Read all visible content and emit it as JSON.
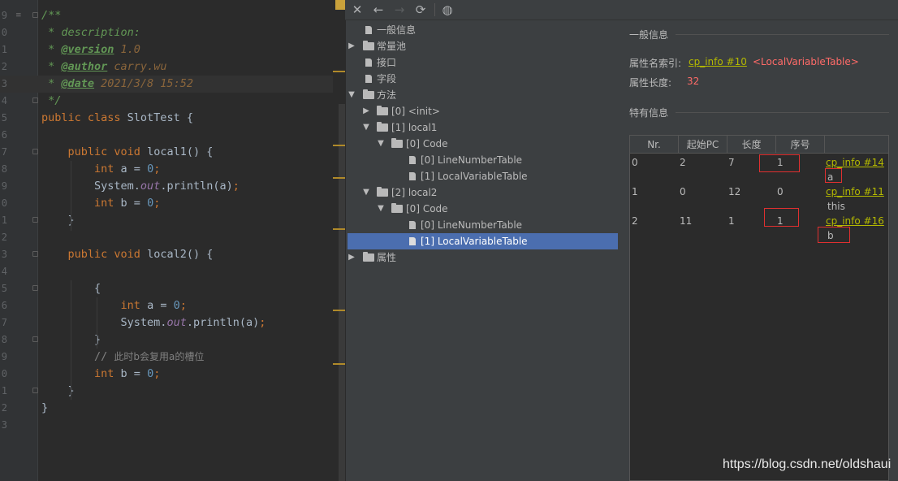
{
  "editor": {
    "line_numbers": [
      "9",
      "0",
      "1",
      "2",
      "3",
      "4",
      "5",
      "6",
      "7",
      "8",
      "9",
      "0",
      "1",
      "2",
      "3",
      "4",
      "5",
      "6",
      "7",
      "8",
      "9",
      "0",
      "1",
      "2",
      "3"
    ]
  },
  "code_lines": [
    [
      {
        "t": "doc",
        "v": "/**"
      }
    ],
    [
      {
        "t": "doc",
        "v": " * description:"
      }
    ],
    [
      {
        "t": "doc",
        "v": " * "
      },
      {
        "t": "tag",
        "v": "@version"
      },
      {
        "t": "tv",
        "v": " 1.0"
      }
    ],
    [
      {
        "t": "doc",
        "v": " * "
      },
      {
        "t": "tag",
        "v": "@author"
      },
      {
        "t": "tv",
        "v": " carry.wu"
      }
    ],
    [
      {
        "t": "doc",
        "v": " * "
      },
      {
        "t": "tag",
        "v": "@date"
      },
      {
        "t": "tv",
        "v": " 2021/3/8 15:52"
      }
    ],
    [
      {
        "t": "doc",
        "v": " */"
      }
    ],
    [
      {
        "t": "kw",
        "v": "public class "
      },
      {
        "t": "cls",
        "v": "SlotTest {"
      }
    ],
    [],
    [
      {
        "t": "txt",
        "v": "    "
      },
      {
        "t": "kw",
        "v": "public void "
      },
      {
        "t": "txt",
        "v": "local1() {"
      }
    ],
    [
      {
        "t": "txt",
        "v": "        "
      },
      {
        "t": "kw",
        "v": "int "
      },
      {
        "t": "txt",
        "v": "a = "
      },
      {
        "t": "num",
        "v": "0"
      },
      {
        "t": "kw",
        "v": ";"
      }
    ],
    [
      {
        "t": "txt",
        "v": "        System."
      },
      {
        "t": "fld",
        "v": "out"
      },
      {
        "t": "txt",
        "v": ".println(a)"
      },
      {
        "t": "kw",
        "v": ";"
      }
    ],
    [
      {
        "t": "txt",
        "v": "        "
      },
      {
        "t": "kw",
        "v": "int "
      },
      {
        "t": "txt",
        "v": "b = "
      },
      {
        "t": "num",
        "v": "0"
      },
      {
        "t": "kw",
        "v": ";"
      }
    ],
    [
      {
        "t": "txt",
        "v": "    }"
      }
    ],
    [],
    [
      {
        "t": "txt",
        "v": "    "
      },
      {
        "t": "kw",
        "v": "public void "
      },
      {
        "t": "txt",
        "v": "local2() {"
      }
    ],
    [],
    [
      {
        "t": "txt",
        "v": "        {"
      }
    ],
    [
      {
        "t": "txt",
        "v": "            "
      },
      {
        "t": "kw",
        "v": "int "
      },
      {
        "t": "txt",
        "v": "a = "
      },
      {
        "t": "num",
        "v": "0"
      },
      {
        "t": "kw",
        "v": ";"
      }
    ],
    [
      {
        "t": "txt",
        "v": "            System."
      },
      {
        "t": "fld",
        "v": "out"
      },
      {
        "t": "txt",
        "v": ".println(a)"
      },
      {
        "t": "kw",
        "v": ";"
      }
    ],
    [
      {
        "t": "txt",
        "v": "        }"
      }
    ],
    [
      {
        "t": "txt",
        "v": "        "
      },
      {
        "t": "cmt",
        "v": "// "
      },
      {
        "t": "cmtcn",
        "v": "此时b会复用a的槽位"
      }
    ],
    [
      {
        "t": "txt",
        "v": "        "
      },
      {
        "t": "kw",
        "v": "int "
      },
      {
        "t": "txt",
        "v": "b = "
      },
      {
        "t": "num",
        "v": "0"
      },
      {
        "t": "kw",
        "v": ";"
      }
    ],
    [
      {
        "t": "txt",
        "v": "    }"
      }
    ],
    [
      {
        "t": "txt",
        "v": "}"
      }
    ],
    []
  ],
  "toolbar": {
    "close_icon": "close-icon",
    "back_icon": "arrow-left-icon",
    "forward_icon": "arrow-right-icon",
    "refresh_icon": "refresh-icon",
    "web_icon": "globe-icon"
  },
  "tree": {
    "general_info": "一般信息",
    "constant_pool": "常量池",
    "interfaces": "接口",
    "fields": "字段",
    "methods": "方法",
    "init": "[0] <init>",
    "local1": "[1] local1",
    "local1_code": "[0] Code",
    "local1_lnt": "[0] LineNumberTable",
    "local1_lvt": "[1] LocalVariableTable",
    "local2": "[2] local2",
    "local2_code": "[0] Code",
    "local2_lnt": "[0] LineNumberTable",
    "local2_lvt": "[1] LocalVariableTable",
    "attributes": "属性"
  },
  "details": {
    "general_title": "一般信息",
    "name_index_key": "属性名索引:",
    "name_index_link": "cp_info #10",
    "name_index_value": "<LocalVariableTable>",
    "length_key": "属性长度:",
    "length_value": "32",
    "specific_title": "特有信息",
    "columns": [
      "Nr.",
      "起始PC",
      "长度",
      "序号"
    ],
    "rows": [
      {
        "nr": "0",
        "start_pc": "2",
        "length": "7",
        "index": "1",
        "name_link": "cp_info #14",
        "name": "a"
      },
      {
        "nr": "1",
        "start_pc": "0",
        "length": "12",
        "index": "0",
        "name_link": "cp_info #11",
        "name": "this"
      },
      {
        "nr": "2",
        "start_pc": "11",
        "length": "1",
        "index": "1",
        "name_link": "cp_info #16",
        "name": "b"
      }
    ]
  },
  "watermark": "https://blog.csdn.net/oldshaui",
  "colors": {
    "selection": "#4b6eaf",
    "link": "#b4b900",
    "red_value": "#ff6b68",
    "highlight_box": "#e03030"
  }
}
